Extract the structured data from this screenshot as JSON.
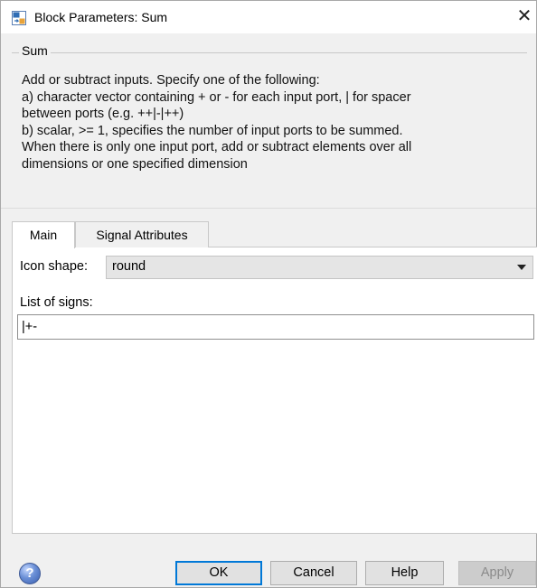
{
  "window": {
    "title": "Block Parameters: Sum",
    "close_glyph": "✕"
  },
  "description": {
    "group_title": "Sum",
    "text": "Add or subtract inputs.  Specify one of the following:\na) character vector containing + or - for each input port, | for spacer\nbetween ports (e.g. ++|-|++)\nb) scalar, >= 1, specifies the number of input ports to be summed.\nWhen there is only one input port, add or subtract elements over all\ndimensions or one specified dimension"
  },
  "tabs": [
    {
      "label": "Main",
      "active": true
    },
    {
      "label": "Signal Attributes",
      "active": false
    }
  ],
  "main": {
    "icon_shape_label": "Icon shape:",
    "icon_shape_value": "round",
    "list_of_signs_label": "List of signs:",
    "list_of_signs_value": "|+-"
  },
  "buttons": {
    "ok": "OK",
    "cancel": "Cancel",
    "help": "Help",
    "apply": "Apply",
    "help_icon": "?"
  }
}
